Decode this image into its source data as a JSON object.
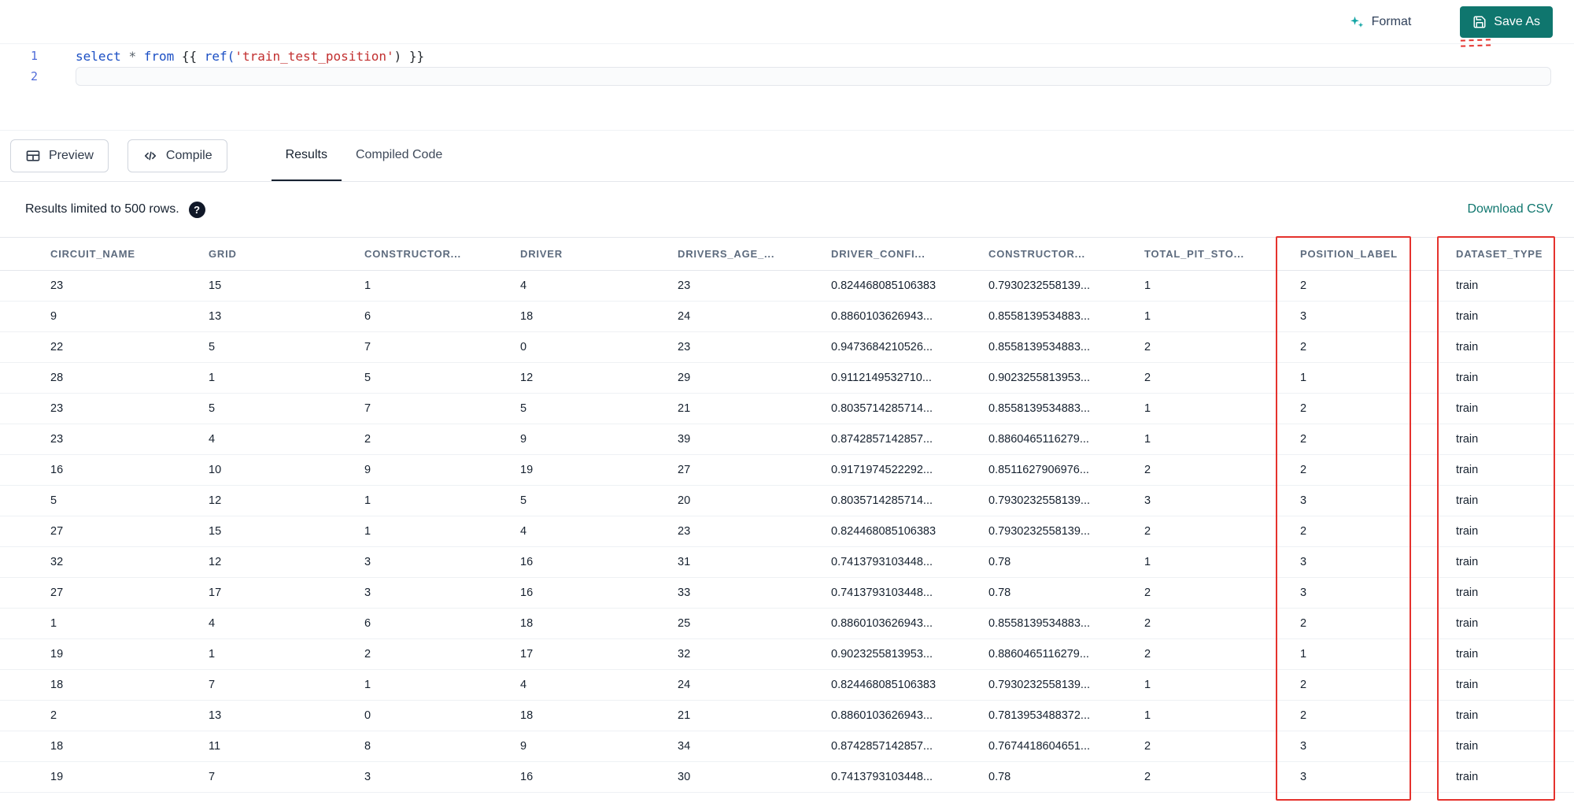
{
  "toolbar": {
    "format_label": "Format",
    "save_as_label": "Save As"
  },
  "editor": {
    "line_numbers": [
      "1",
      "2"
    ],
    "line1_tokens": [
      {
        "text": "select",
        "type": "keyword"
      },
      {
        "text": " ",
        "type": "plain"
      },
      {
        "text": "*",
        "type": "operator"
      },
      {
        "text": " ",
        "type": "plain"
      },
      {
        "text": "from",
        "type": "keyword"
      },
      {
        "text": " {{ ",
        "type": "plain"
      },
      {
        "text": "ref(",
        "type": "function"
      },
      {
        "text": "'train_test_position'",
        "type": "string"
      },
      {
        "text": ") }}",
        "type": "plain"
      }
    ]
  },
  "actions": {
    "preview_label": "Preview",
    "compile_label": "Compile"
  },
  "tabs": [
    {
      "label": "Results",
      "active": true
    },
    {
      "label": "Compiled Code",
      "active": false
    }
  ],
  "results_bar": {
    "info_text": "Results limited to 500 rows.",
    "help_glyph": "?",
    "download_label": "Download CSV"
  },
  "table": {
    "columns": [
      "CIRCUIT_NAME",
      "GRID",
      "CONSTRUCTOR...",
      "DRIVER",
      "DRIVERS_AGE_...",
      "DRIVER_CONFI...",
      "CONSTRUCTOR...",
      "TOTAL_PIT_STO...",
      "POSITION_LABEL",
      "DATASET_TYPE"
    ],
    "rows": [
      [
        "23",
        "15",
        "1",
        "4",
        "23",
        "0.824468085106383",
        "0.7930232558139...",
        "1",
        "2",
        "train"
      ],
      [
        "9",
        "13",
        "6",
        "18",
        "24",
        "0.8860103626943...",
        "0.8558139534883...",
        "1",
        "3",
        "train"
      ],
      [
        "22",
        "5",
        "7",
        "0",
        "23",
        "0.9473684210526...",
        "0.8558139534883...",
        "2",
        "2",
        "train"
      ],
      [
        "28",
        "1",
        "5",
        "12",
        "29",
        "0.9112149532710...",
        "0.9023255813953...",
        "2",
        "1",
        "train"
      ],
      [
        "23",
        "5",
        "7",
        "5",
        "21",
        "0.8035714285714...",
        "0.8558139534883...",
        "1",
        "2",
        "train"
      ],
      [
        "23",
        "4",
        "2",
        "9",
        "39",
        "0.8742857142857...",
        "0.8860465116279...",
        "1",
        "2",
        "train"
      ],
      [
        "16",
        "10",
        "9",
        "19",
        "27",
        "0.9171974522292...",
        "0.8511627906976...",
        "2",
        "2",
        "train"
      ],
      [
        "5",
        "12",
        "1",
        "5",
        "20",
        "0.8035714285714...",
        "0.7930232558139...",
        "3",
        "3",
        "train"
      ],
      [
        "27",
        "15",
        "1",
        "4",
        "23",
        "0.824468085106383",
        "0.7930232558139...",
        "2",
        "2",
        "train"
      ],
      [
        "32",
        "12",
        "3",
        "16",
        "31",
        "0.7413793103448...",
        "0.78",
        "1",
        "3",
        "train"
      ],
      [
        "27",
        "17",
        "3",
        "16",
        "33",
        "0.7413793103448...",
        "0.78",
        "2",
        "3",
        "train"
      ],
      [
        "1",
        "4",
        "6",
        "18",
        "25",
        "0.8860103626943...",
        "0.8558139534883...",
        "2",
        "2",
        "train"
      ],
      [
        "19",
        "1",
        "2",
        "17",
        "32",
        "0.9023255813953...",
        "0.8860465116279...",
        "2",
        "1",
        "train"
      ],
      [
        "18",
        "7",
        "1",
        "4",
        "24",
        "0.824468085106383",
        "0.7930232558139...",
        "1",
        "2",
        "train"
      ],
      [
        "2",
        "13",
        "0",
        "18",
        "21",
        "0.8860103626943...",
        "0.7813953488372...",
        "1",
        "2",
        "train"
      ],
      [
        "18",
        "11",
        "8",
        "9",
        "34",
        "0.8742857142857...",
        "0.7674418604651...",
        "2",
        "3",
        "train"
      ],
      [
        "19",
        "7",
        "3",
        "16",
        "30",
        "0.7413793103448...",
        "0.78",
        "2",
        "3",
        "train"
      ]
    ],
    "highlighted_columns": [
      "POSITION_LABEL",
      "DATASET_TYPE"
    ]
  },
  "colors": {
    "accent_teal": "#0f766e",
    "sparkle_teal": "#12a5a5",
    "highlight_red": "#e5322d",
    "keyword_blue": "#1b4fc4",
    "string_red": "#c22f2f"
  }
}
